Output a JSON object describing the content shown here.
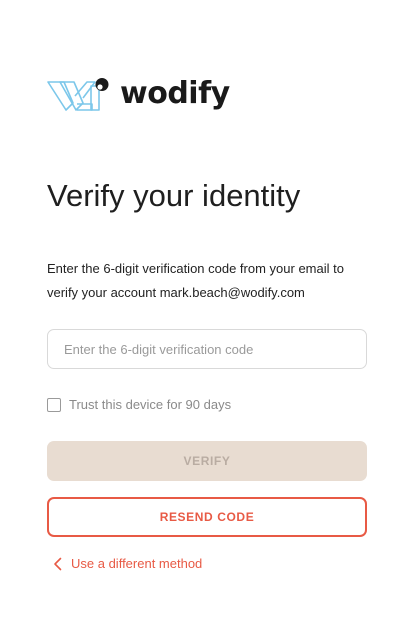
{
  "brand": {
    "name": "wodify",
    "logo_icon": "wodify-logo-icon",
    "logo_colors": [
      "#7cc7ea",
      "#1a1a1a"
    ]
  },
  "header": {
    "title": "Verify your identity"
  },
  "instructions": {
    "text": "Enter the 6-digit verification code from your email to verify your account mark.beach@wodify.com"
  },
  "form": {
    "code_value": "",
    "code_placeholder": "Enter the 6-digit verification code",
    "trust_checked": false,
    "trust_label": "Trust this device for 90 days",
    "verify_label": "VERIFY",
    "resend_label": "RESEND CODE",
    "different_method_label": "Use a different method",
    "back_icon": "chevron-left-icon"
  },
  "colors": {
    "accent": "#e85a45",
    "disabled_bg": "#e8dcd1",
    "disabled_text": "#b9aca2"
  }
}
